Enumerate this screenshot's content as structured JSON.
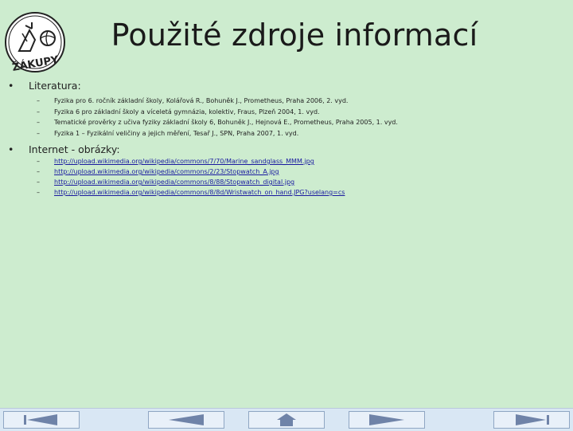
{
  "title": "Použité zdroje informací",
  "logo": {
    "text": "ŽÁKUPY",
    "icon": "school-logo-icon"
  },
  "sections": [
    {
      "bullet": "•",
      "heading": "Literatura:",
      "items": [
        "Fyzika pro 6. ročník základní školy, Kolářová R., Bohuněk J., Prometheus, Praha 2006, 2. vyd.",
        "Fyzika 6 pro základní školy a víceletá gymnázia, kolektiv, Fraus, Plzeň 2004, 1. vyd.",
        "Tematické prověrky z učiva fyziky základní školy 6, Bohuněk J., Hejnová E., Prometheus, Praha 2005, 1. vyd.",
        "Fyzika 1 – Fyzikální veličiny a jejich měření, Tesař J., SPN, Praha 2007, 1. vyd."
      ]
    },
    {
      "bullet": "•",
      "heading": "Internet - obrázky:",
      "items": [
        "http://upload.wikimedia.org/wikipedia/commons/7/70/Marine_sandglass_MMM.jpg",
        "http://upload.wikimedia.org/wikipedia/commons/2/23/Stopwatch_A.jpg",
        "http://upload.wikimedia.org/wikipedia/commons/8/88/Stopwatch_digital.jpg",
        "http://upload.wikimedia.org/wikipedia/commons/8/8d/Wristwatch_on_hand.JPG?uselang=cs"
      ]
    }
  ],
  "dash": "–",
  "nav": {
    "buttons": [
      {
        "name": "first-slide-button",
        "icon": "first-arrow-icon"
      },
      {
        "name": "previous-slide-button",
        "icon": "left-arrow-icon"
      },
      {
        "name": "menu-button",
        "icon": "home-icon"
      },
      {
        "name": "next-slide-button",
        "icon": "right-arrow-icon"
      },
      {
        "name": "last-slide-button",
        "icon": "last-arrow-icon"
      }
    ],
    "colors": {
      "arrow": "#6f83a8",
      "bar": "#d9e7f4"
    }
  }
}
